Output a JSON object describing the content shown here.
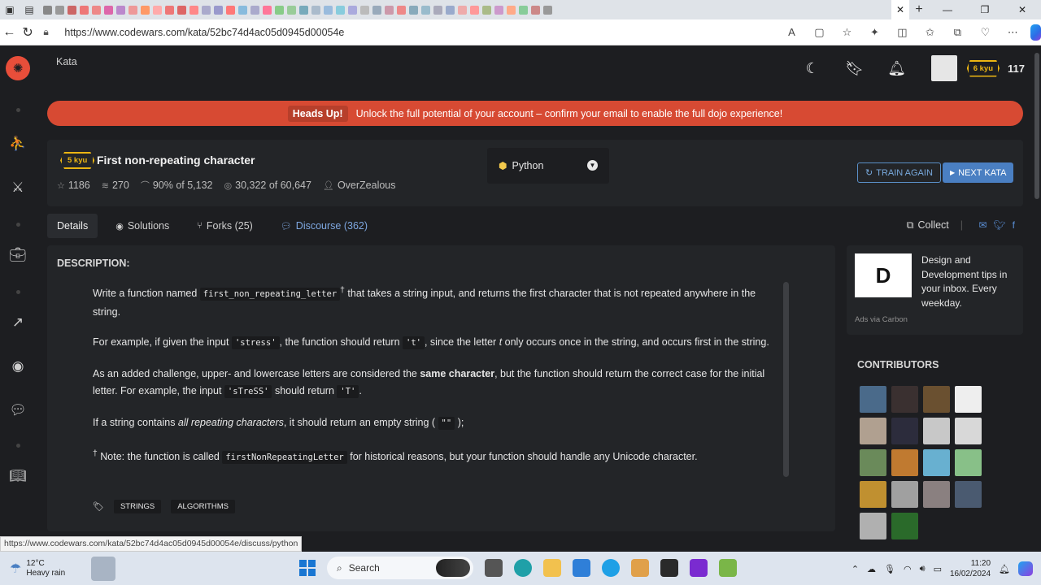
{
  "browser": {
    "url": "https://www.codewars.com/kata/52bc74d4ac05d0945d00054e",
    "status_url": "https://www.codewars.com/kata/52bc74d4ac05d0945d00054e/discuss/python"
  },
  "topbar": {
    "section": "Kata",
    "rank": "6 kyu",
    "honor": "117"
  },
  "banner": {
    "heading": "Heads Up!",
    "message": "Unlock the full potential of your account – confirm your email to enable the full dojo experience!"
  },
  "kata": {
    "rank": "5 kyu",
    "title": "First non-repeating character",
    "stars": "1186",
    "collections": "270",
    "satisfaction": "90% of 5,132",
    "completed": "30,322 of 60,647",
    "author": "OverZealous",
    "language": "Python",
    "train_again": "TRAIN AGAIN",
    "next_kata": "NEXT KATA"
  },
  "tabs": {
    "details": "Details",
    "solutions": "Solutions",
    "forks": "Forks (25)",
    "discourse": "Discourse (362)",
    "collect": "Collect"
  },
  "description": {
    "label": "DESCRIPTION:",
    "p1_a": "Write a function named ",
    "p1_code": "first_non_repeating_letter",
    "p1_sup": "†",
    "p1_b": " that takes a string input, and returns the first character that is not repeated anywhere in the string.",
    "p2_a": "For example, if given the input ",
    "p2_code1": "'stress'",
    "p2_b": ", the function should return ",
    "p2_code2": "'t'",
    "p2_c": ", since the letter ",
    "p2_em": "t",
    "p2_d": " only occurs once in the string, and occurs first in the string.",
    "p3_a": "As an added challenge, upper- and lowercase letters are considered the ",
    "p3_strong": "same character",
    "p3_b": ", but the function should return the correct case for the initial letter. For example, the input ",
    "p3_code1": "'sTreSS'",
    "p3_c": " should return ",
    "p3_code2": "'T'",
    "p3_d": ".",
    "p4_a": "If a string contains ",
    "p4_em": "all repeating characters",
    "p4_b": ", it should return an empty string (",
    "p4_code": "\"\"",
    "p4_c": ");",
    "p5_sup": "†",
    "p5_a": " Note: the function is called ",
    "p5_code": "firstNonRepeatingLetter",
    "p5_b": " for historical reasons, but your function should handle any Unicode character.",
    "tags": [
      "STRINGS",
      "ALGORITHMS"
    ]
  },
  "ad": {
    "text": "Design and Development tips in your inbox. Every weekday.",
    "via": "Ads via Carbon"
  },
  "contributors": {
    "title": "CONTRIBUTORS",
    "avatars": [
      "#4a6a8a",
      "#3a3030",
      "#6a5030",
      "#eeeeee",
      "#b0a090",
      "#2c2c3c",
      "#c8c8c8",
      "#d8d8d8",
      "#6a8a5a",
      "#c07a30",
      "#68b0d0",
      "#88c088",
      "#c09030",
      "#a0a0a0",
      "#8a8080",
      "#4a5a70",
      "#b0b0b0",
      "#2a6a2a"
    ]
  },
  "taskbar": {
    "temp": "12°C",
    "weather": "Heavy rain",
    "search": "Search",
    "time": "11:20",
    "date": "16/02/2024"
  }
}
